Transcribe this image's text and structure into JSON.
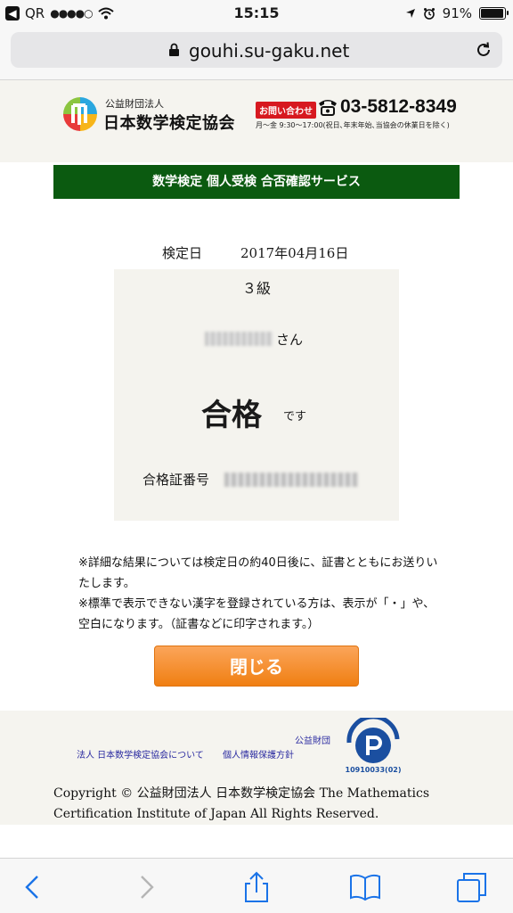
{
  "status": {
    "carrier": "QR",
    "signal_dots": "●●●●○",
    "time": "15:15",
    "battery": "91%"
  },
  "browser": {
    "url": "gouhi.su-gaku.net"
  },
  "header": {
    "org_prefix": "公益財団法人",
    "org_name": "日本数学検定協会",
    "contact_label": "お問い合わせ",
    "phone": "03-5812-8349",
    "hours": "月～金 9:30～17:00(祝日､年末年始､当協会の休業日を除く)"
  },
  "service_title": "数学検定 個人受検 合否確認サービス",
  "result": {
    "exam_date_label": "検定日",
    "exam_date": "2017年04月16日",
    "grade": "３級",
    "honorific": "さん",
    "pass": "合格",
    "desu": "です",
    "cert_label": "合格証番号"
  },
  "notes": [
    "※詳細な結果については検定日の約40日後に、証書とともにお送りいたします。",
    "※標準で表示できない漢字を登録されている方は、表示が「・」や、空白になります。（証書などに印字されます。）"
  ],
  "close_label": "閉じる",
  "footer": {
    "org_label": "公益財団",
    "about_link": "法人 日本数学検定協会について",
    "privacy_link": "個人情報保護方針",
    "privacy_mark_text": "10910033(02)",
    "copyright": "Copyright © 公益財団法人 日本数学検定協会 The Mathematics Certification Institute of Japan All Rights Reserved."
  },
  "colors": {
    "header_green": "#0b5a10",
    "button_orange": "#f58a25",
    "link_blue": "#2a2aa0",
    "contact_red": "#d71920"
  }
}
